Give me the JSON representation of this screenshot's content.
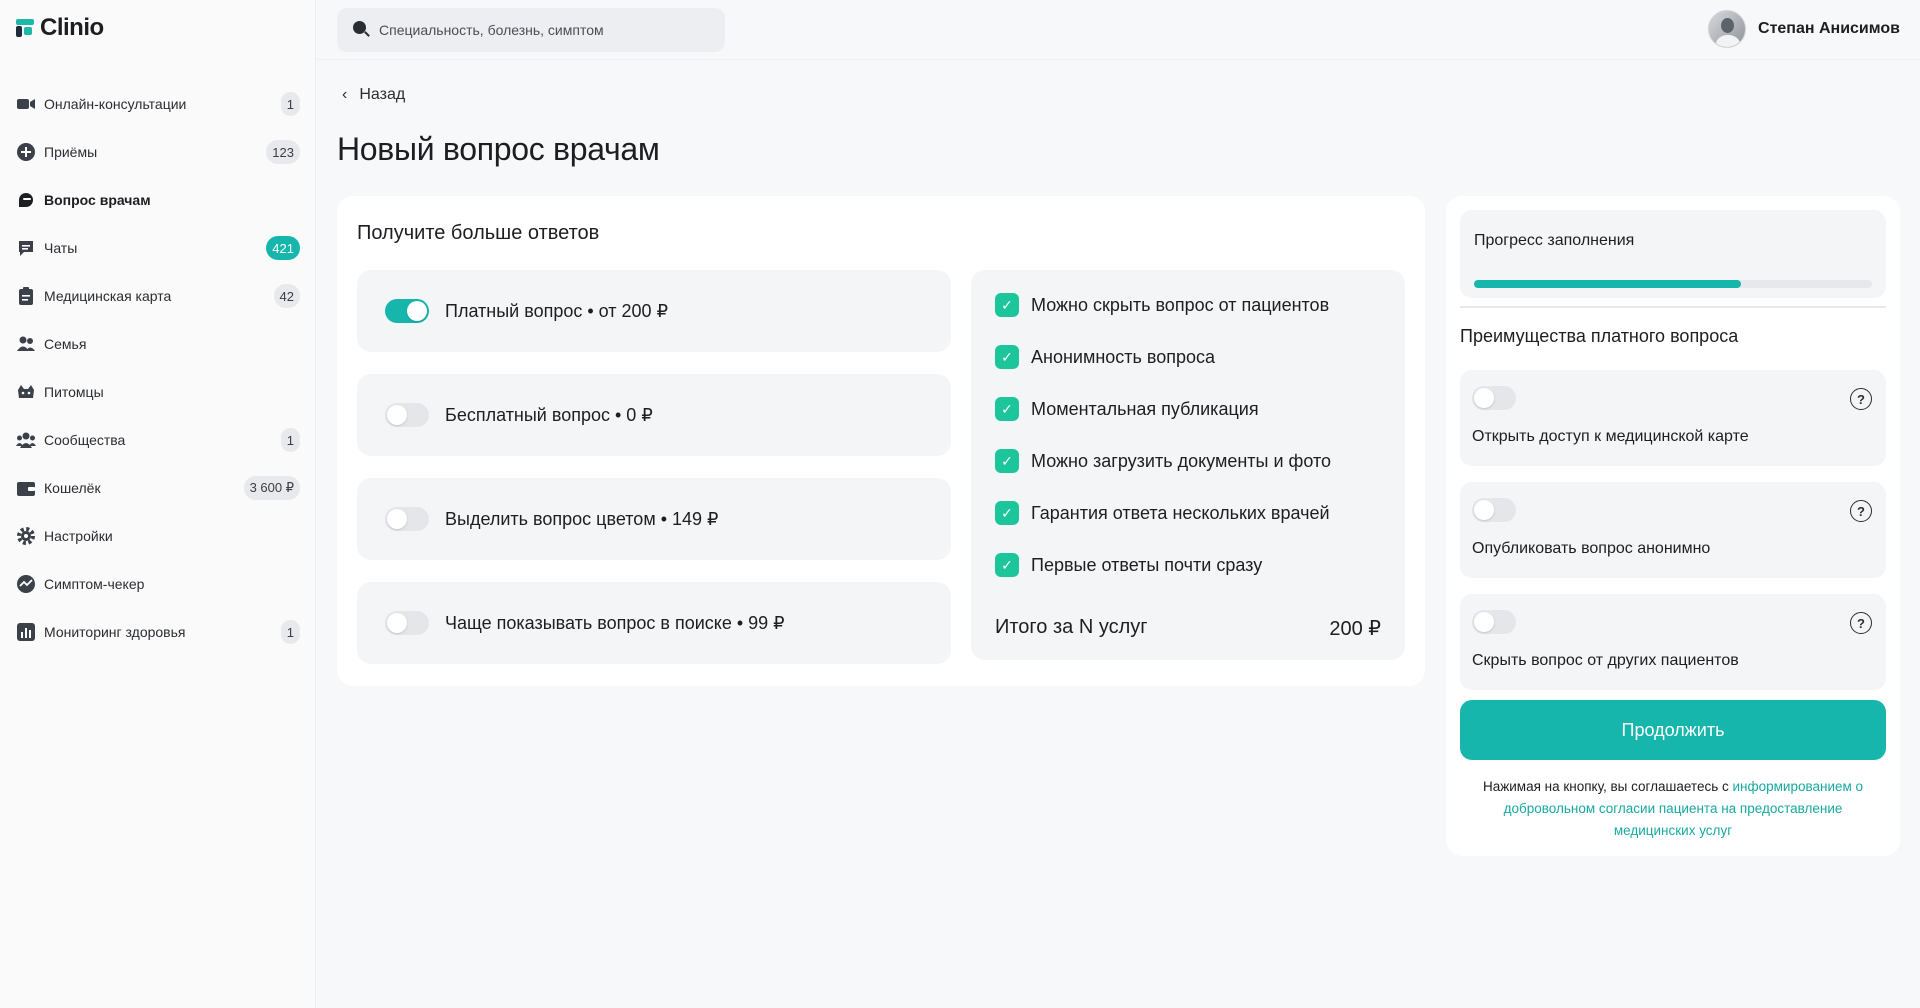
{
  "app": {
    "name": "Clinio"
  },
  "sidebar": {
    "items": [
      {
        "label": "Онлайн-консультации",
        "badge": "1",
        "icon": "video-icon"
      },
      {
        "label": "Приёмы",
        "badge": "123",
        "icon": "plus-circle-icon"
      },
      {
        "label": "Вопрос врачам",
        "badge": "",
        "icon": "chat-question-icon"
      },
      {
        "label": "Чаты",
        "badge": "421",
        "icon": "chat-icon"
      },
      {
        "label": "Медицинская карта",
        "badge": "42",
        "icon": "clipboard-icon"
      },
      {
        "label": "Семья",
        "badge": "",
        "icon": "family-icon"
      },
      {
        "label": "Питомцы",
        "badge": "",
        "icon": "paw-icon"
      },
      {
        "label": "Сообщества",
        "badge": "1",
        "icon": "community-icon"
      },
      {
        "label": "Кошелёк",
        "badge": "3 600 ₽",
        "icon": "wallet-icon"
      },
      {
        "label": "Настройки",
        "badge": "",
        "icon": "gear-icon"
      },
      {
        "label": "Симптом-чекер",
        "badge": "",
        "icon": "pulse-icon"
      },
      {
        "label": "Мониторинг здоровья",
        "badge": "1",
        "icon": "bar-chart-icon"
      }
    ]
  },
  "header": {
    "search_placeholder": "Специальность, болезнь, симптом",
    "user_name": "Степан Анисимов"
  },
  "main": {
    "back_label": "Назад",
    "title": "Новый вопрос врачам",
    "card_title": "Получите больше ответов",
    "options": [
      {
        "label": "Платный вопрос • от 200 ₽",
        "on": true
      },
      {
        "label": "Бесплатный вопрос • 0 ₽",
        "on": false
      },
      {
        "label": "Выделить вопрос цветом • 149 ₽",
        "on": false
      },
      {
        "label": "Чаще показывать вопрос в поиске • 99 ₽",
        "on": false
      }
    ],
    "features": [
      "Можно скрыть вопрос от пациентов",
      "Анонимность вопроса",
      "Моментальная публикация",
      "Можно загрузить документы и фото",
      "Гарантия ответа нескольких врачей",
      "Первые ответы почти сразу"
    ],
    "total_label": "Итого за N услуг",
    "total_value": "200 ₽"
  },
  "right_panel": {
    "progress_label": "Прогресс заполнения",
    "progress_value": 0.67,
    "advantages_title": "Преимущества платного вопроса",
    "advantages": [
      {
        "label": "Открыть доступ к медицинской карте",
        "on": false
      },
      {
        "label": "Опубликовать вопрос анонимно",
        "on": false
      },
      {
        "label": "Скрыть вопрос от других пациентов",
        "on": false
      }
    ],
    "continue_label": "Продолжить",
    "consent_text": "Нажимая на кнопку, вы соглашаетесь с ",
    "consent_link": "информированием о добровольном согласии пациента на предоставление медицинских услуг"
  },
  "colors": {
    "accent": "#17b6ad",
    "check": "#1dc59a"
  }
}
